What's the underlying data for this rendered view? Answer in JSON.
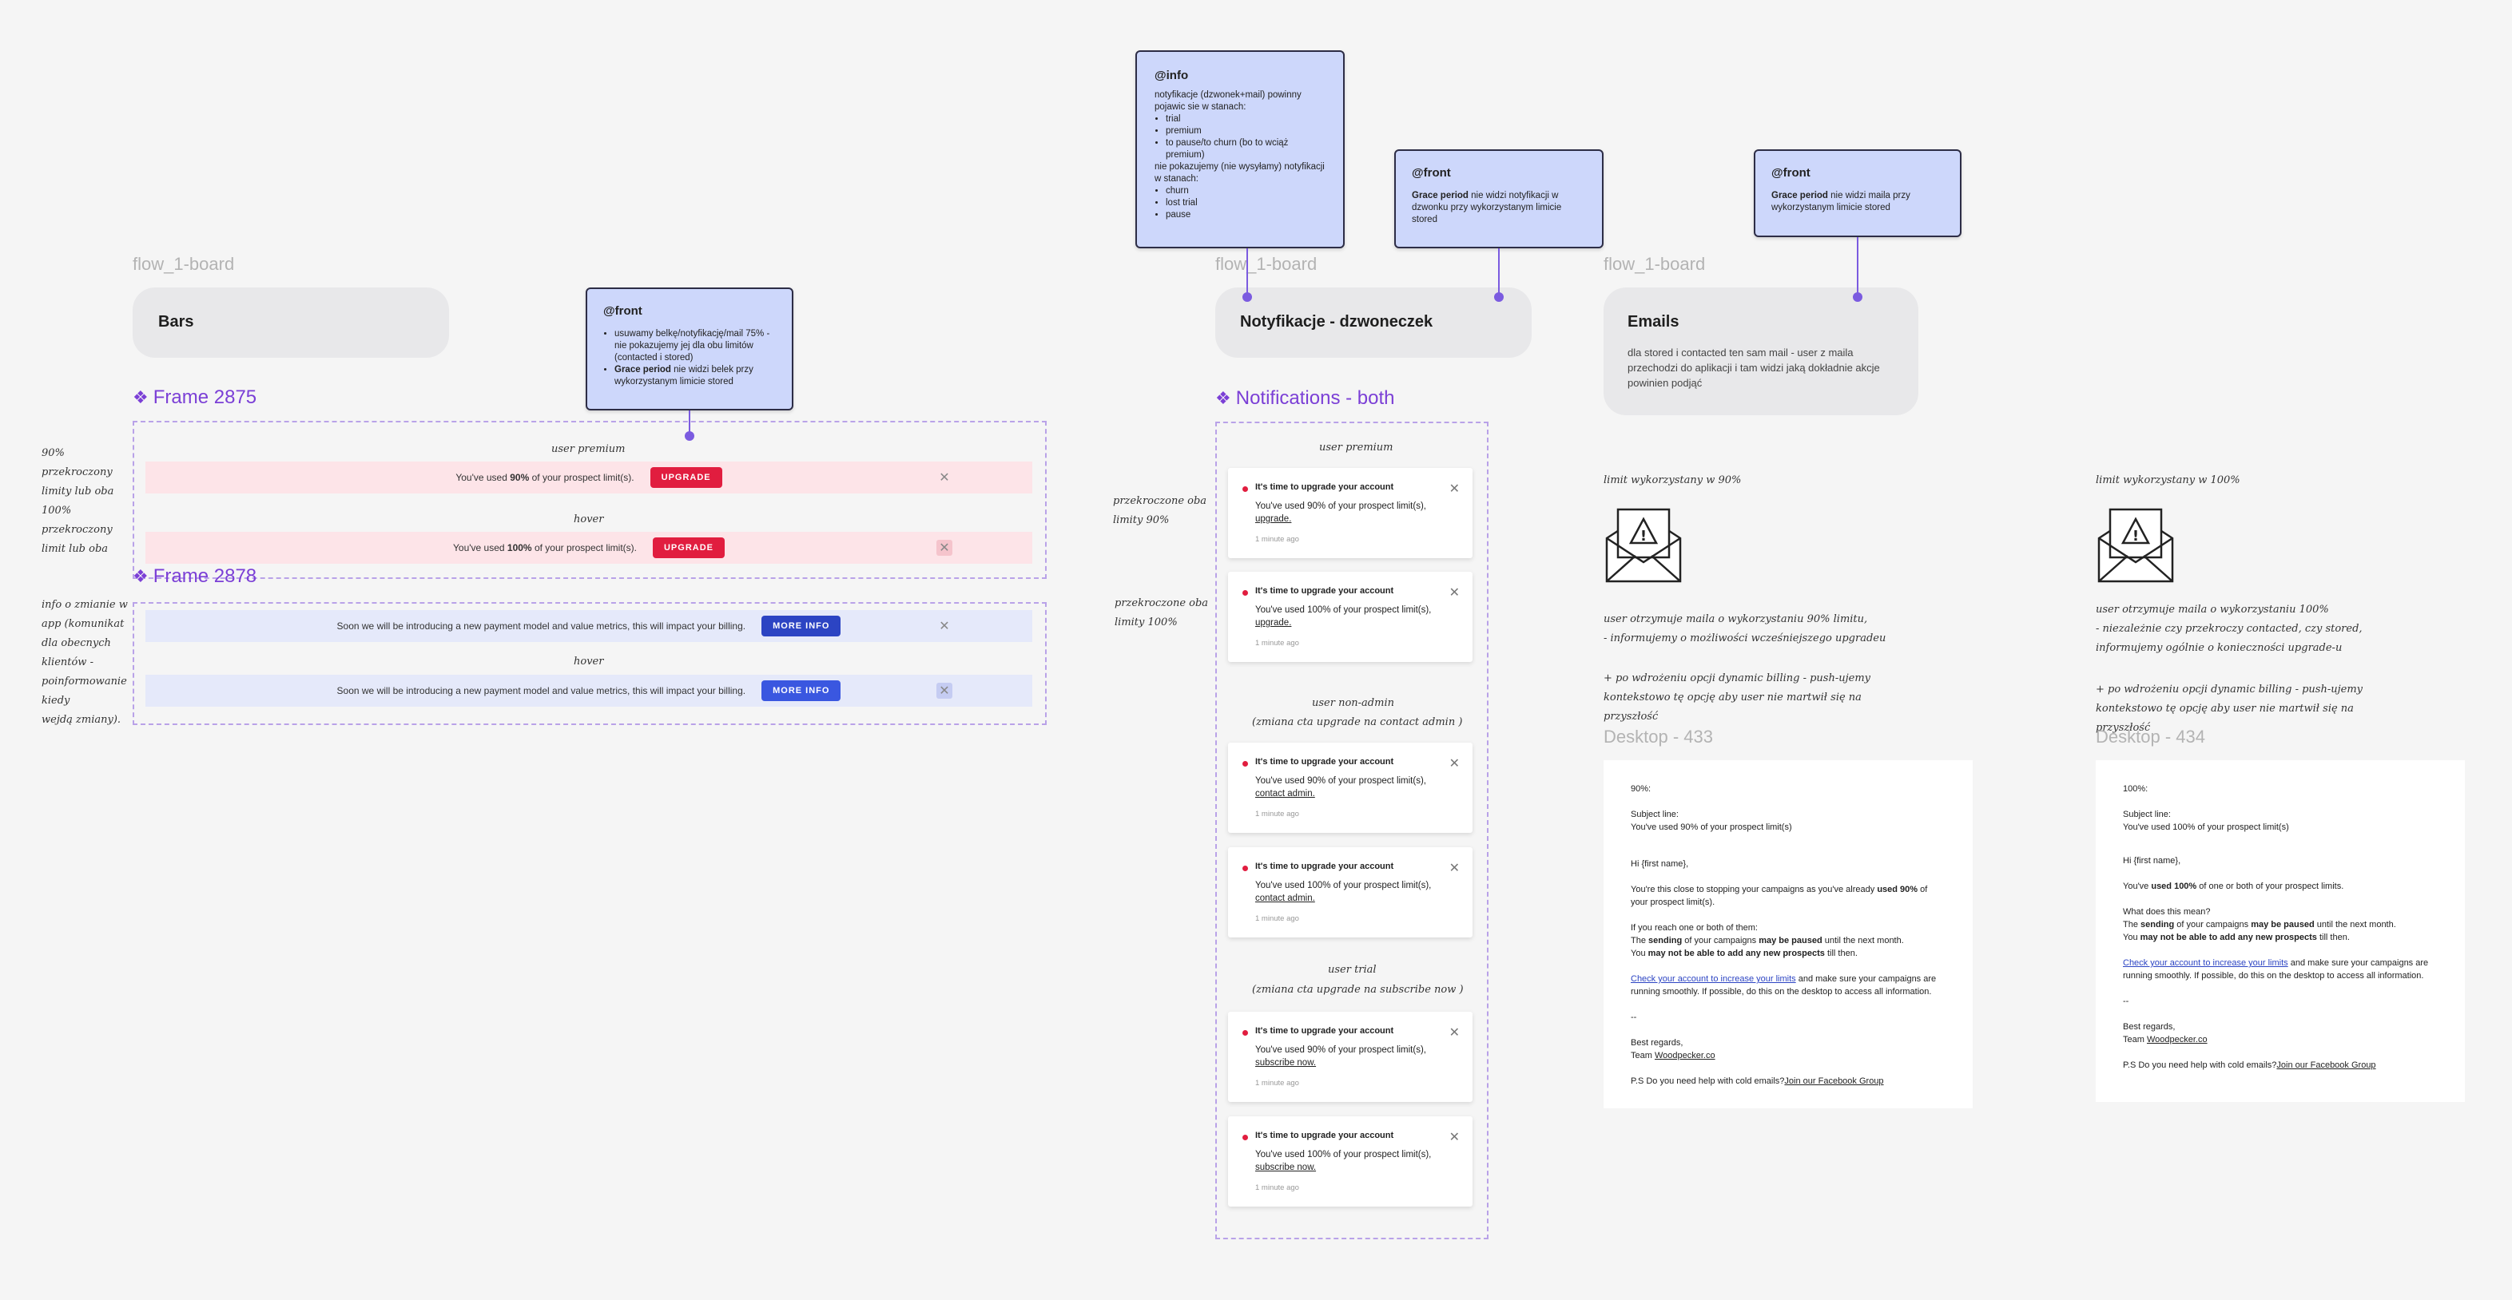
{
  "bars_section": {
    "board_label": "flow_1-board",
    "title": "Bars",
    "frame_2875_label": "Frame 2875",
    "frame_2878_label": "Frame 2878",
    "user_premium_label": "user premium",
    "hover_label_1": "hover",
    "hover_label_2": "hover",
    "bar1_text_pre": "You've used ",
    "bar1_text_bold": "90%",
    "bar1_text_post": " of your prospect limit(s).",
    "bar2_text_pre": "You've used ",
    "bar2_text_bold": "100%",
    "bar2_text_post": " of your prospect limit(s).",
    "upgrade_label": "UPGRADE",
    "info_bar_text": "Soon we will be introducing a new payment model and value metrics, this will impact your billing.",
    "more_info_label": "MORE INFO",
    "side_note_1": [
      "90%",
      "przekroczony",
      "limity lub oba",
      "100%",
      "przekroczony",
      "limit lub oba"
    ],
    "side_note_2": [
      "info o zmianie w",
      "app (komunikat",
      "dla obecnych",
      "klientów -",
      "poinformowanie",
      "kiedy",
      "wejdą zmiany)."
    ]
  },
  "sticky_front_bars": {
    "title": "@front",
    "item1": "usuwamy belkę/notyfikację/mail 75% - nie pokazujemy jej dla obu limitów (contacted i stored)",
    "item2_bold": "Grace period",
    "item2_rest": " nie widzi belek przy wykorzystanym limicie stored"
  },
  "sticky_info": {
    "title": "@info",
    "intro": "notyfikacje (dzwonek+mail) powinny pojawic sie w stanach:",
    "items_show": [
      "trial",
      "premium",
      "to pause/to churn (bo to wciąż premium)"
    ],
    "middle": "nie pokazujemy (nie wysyłamy) notyfikacji w stanach:",
    "items_hide": [
      "churn",
      "lost trial",
      "pause"
    ]
  },
  "sticky_front_notif": {
    "title": "@front",
    "bold": "Grace period",
    "rest": " nie widzi notyfikacji w dzwonku przy wykorzystanym limicie stored"
  },
  "sticky_front_emails": {
    "title": "@front",
    "bold": "Grace period",
    "rest": " nie widzi maila przy wykorzystanym limicie stored"
  },
  "notifications_section": {
    "board_label": "flow_1-board",
    "title": "Notyfikacje - dzwoneczek",
    "frame_label": "Notifications - both",
    "side_note_1": [
      "przekroczone oba",
      "limity 90%"
    ],
    "side_note_2": [
      "przekroczone oba",
      "limity 100%"
    ],
    "group_premium_label": "user premium",
    "group_nonadmin_label": "user non-admin",
    "group_nonadmin_sub": "(zmiana cta upgrade na contact admin )",
    "group_trial_label": "user trial",
    "group_trial_sub": "(zmiana cta upgrade na subscribe now )",
    "notif_title": "It's time to upgrade your account",
    "notif_90": "You've used 90% of your prospect limit(s),",
    "notif_100": "You've used 100% of your prospect limit(s),",
    "cta_upgrade": "upgrade.",
    "cta_contact": "contact admin.",
    "cta_subscribe": "subscribe now.",
    "time": "1 minute ago"
  },
  "emails_section": {
    "board_label": "flow_1-board",
    "title": "Emails",
    "description": "dla stored i contacted ten sam mail -  user z maila przechodzi do aplikacji i tam widzi jaką dokładnie akcje powinien podjąć",
    "col1_heading": "limit wykorzystany w 90%",
    "col1_note": [
      "user otrzymuje maila o wykorzystaniu 90% limitu,",
      "- informujemy o możliwości wcześniejszego upgradeu"
    ],
    "col1_note2": [
      "+ po wdrożeniu opcji dynamic billing - push-ujemy",
      "kontekstowo tę opcję aby user nie martwił się na",
      "przyszłość"
    ],
    "col2_heading": "limit wykorzystany w 100%",
    "col2_note": [
      "user otrzymuje maila o wykorzystaniu 100%",
      "- niezależnie czy przekroczy contacted, czy stored,",
      "informujemy ogólnie o konieczności upgrade-u"
    ],
    "col2_note2": [
      "+ po wdrożeniu opcji dynamic billing - push-ujemy",
      "kontekstowo tę opcję aby user nie martwił się na",
      "przyszłość"
    ],
    "desktop_433_label": "Desktop - 433",
    "desktop_434_label": "Desktop - 434",
    "email1": {
      "pct": "90%:",
      "subject_label": "Subject line:",
      "subject": "You've used 90% of your prospect limit(s)",
      "greeting": "Hi {first name},",
      "p1_pre": "You're this close to stopping your campaigns as you've already ",
      "p1_bold": "used 90%",
      "p1_post": " of your prospect limit(s).",
      "p2_line1": "If you reach one or both of them:",
      "p2_line2_pre": "The ",
      "p2_line2_b1": "sending",
      "p2_line2_mid": " of your campaigns ",
      "p2_line2_b2": "may be paused",
      "p2_line2_post": " until the next month.",
      "p2_line3_pre": "You ",
      "p2_line3_bold": "may not be able to add any new prospects",
      "p2_line3_post": " till then.",
      "link": "Check your account to increase your limits",
      "p3_post": " and make sure your campaigns are running smoothly. If possible, do this on the desktop to access all information.",
      "dash": "--",
      "regards": "Best regards,",
      "team_pre": "Team ",
      "team_link": "Woodpecker.co",
      "ps_pre": "P.S Do you need help with cold emails?",
      "ps_link": "Join our Facebook Group"
    },
    "email2": {
      "pct": "100%:",
      "subject_label": "Subject line:",
      "subject": "You've used 100% of your prospect limit(s)",
      "greeting": "Hi {first name},",
      "p1_pre": "You've ",
      "p1_bold": "used 100%",
      "p1_post": " of one or both of your prospect limits.",
      "p2_line1": "What does this mean?",
      "p2_line2_pre": "The ",
      "p2_line2_b1": "sending",
      "p2_line2_mid": " of your campaigns ",
      "p2_line2_b2": "may be paused",
      "p2_line2_post": " until the next month.",
      "p2_line3_pre": "You ",
      "p2_line3_bold": "may not be able to add any new prospects",
      "p2_line3_post": " till then.",
      "link": "Check your account to increase your limits",
      "p3_post": " and make sure your campaigns are running smoothly. If possible, do this on the desktop to access all information.",
      "dash": "--",
      "regards": "Best regards,",
      "team_pre": "Team ",
      "team_link": "Woodpecker.co",
      "ps_pre": "P.S Do you need help with cold emails?",
      "ps_link": "Join our Facebook Group"
    }
  },
  "colors": {
    "accent": "#7b3fd6",
    "upgrade_red": "#e11d3f",
    "more_info_blue": "#2c44c3",
    "sticky_bg": "#cdd7fb"
  }
}
